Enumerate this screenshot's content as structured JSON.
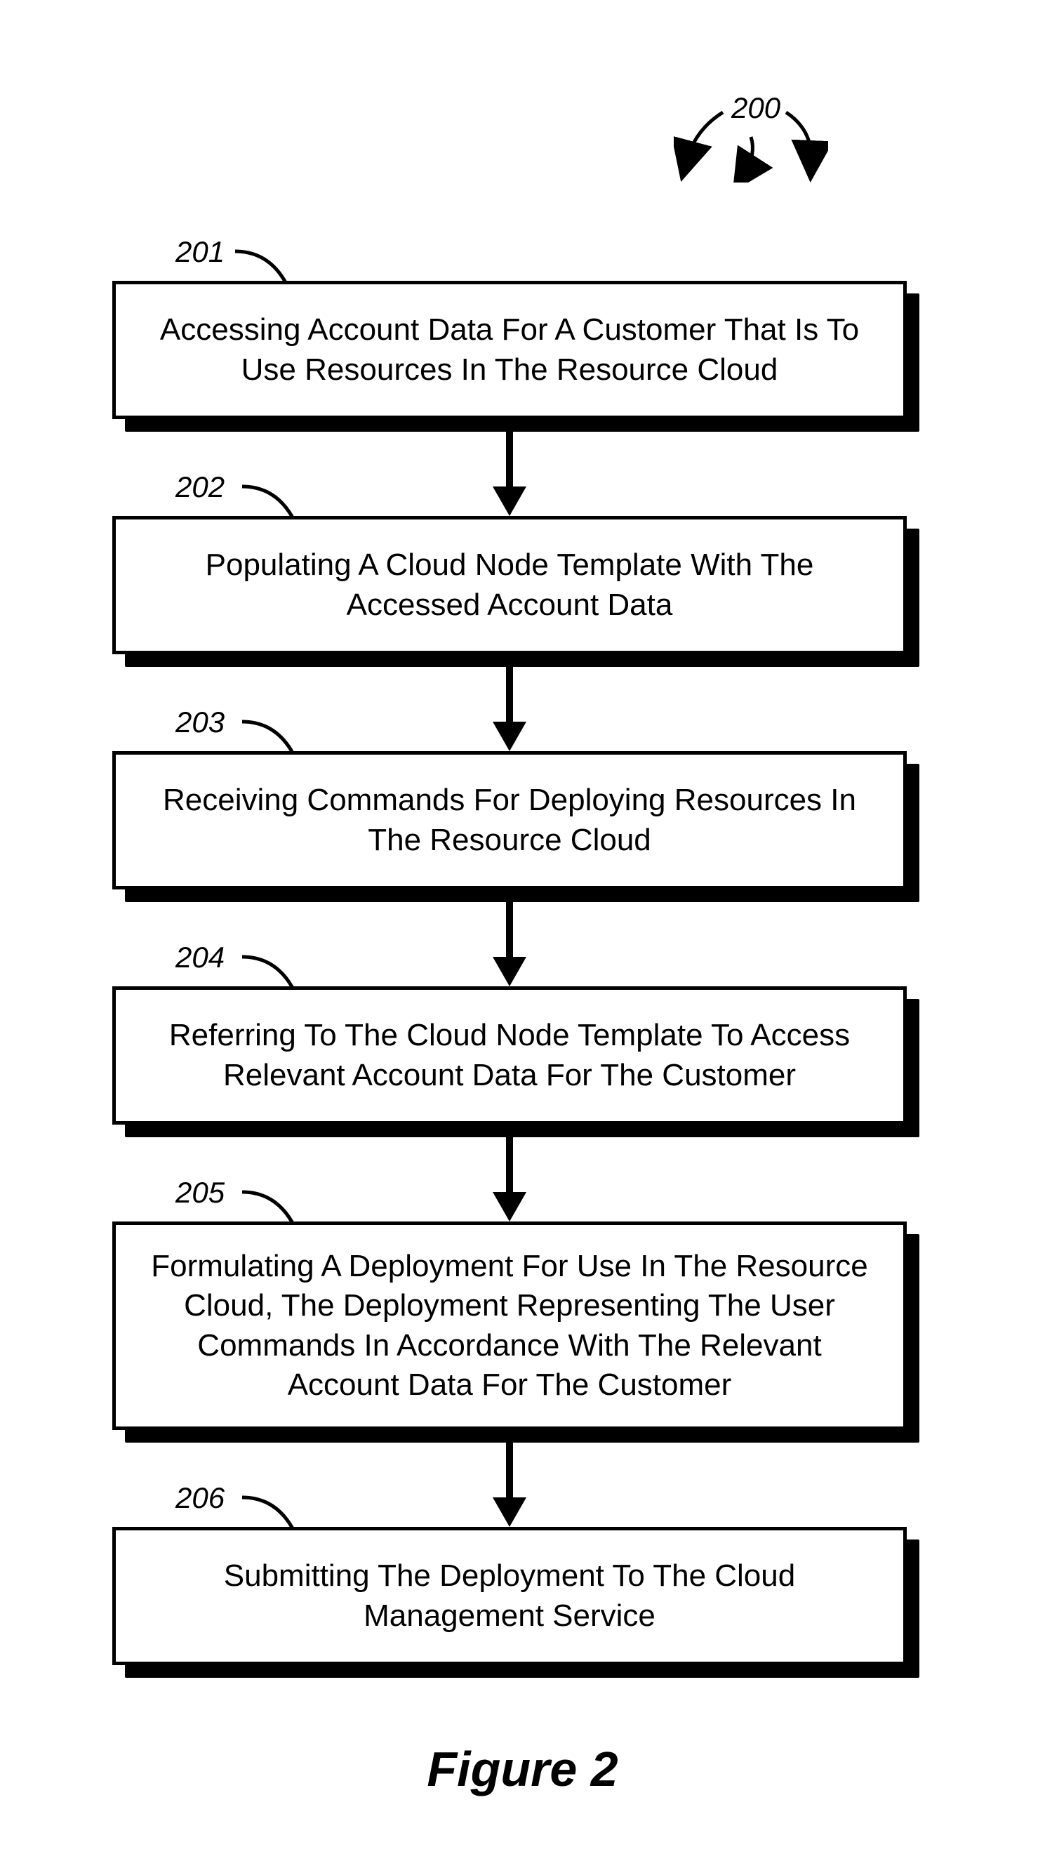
{
  "figure": {
    "ref": "200",
    "caption": "Figure 2",
    "steps": [
      {
        "num": "201",
        "text": "Accessing Account Data For A Customer That Is To Use Resources In The Resource Cloud"
      },
      {
        "num": "202",
        "text": "Populating A Cloud Node Template With The Accessed Account Data"
      },
      {
        "num": "203",
        "text": "Receiving Commands For Deploying Resources In The Resource Cloud"
      },
      {
        "num": "204",
        "text": "Referring To The Cloud Node Template To Access Relevant Account Data For The Customer"
      },
      {
        "num": "205",
        "text": "Formulating A Deployment For Use In The Resource Cloud, The Deployment Representing The User Commands In Accordance With The Relevant Account Data For The Customer"
      },
      {
        "num": "206",
        "text": "Submitting The Deployment To The Cloud Management Service"
      }
    ]
  }
}
